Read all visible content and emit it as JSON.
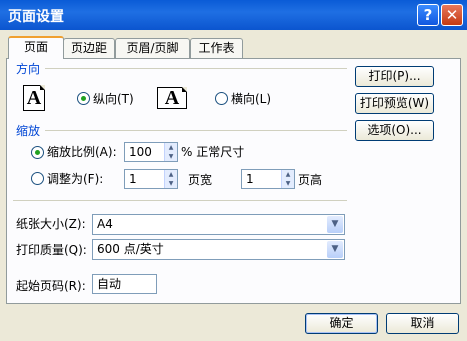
{
  "window": {
    "title": "页面设置",
    "help_glyph": "?",
    "close_glyph": "✕"
  },
  "tabs": [
    "页面",
    "页边距",
    "页眉/页脚",
    "工作表"
  ],
  "orientation": {
    "section_label": "方向",
    "portrait_icon_letter": "A",
    "landscape_icon_letter": "A",
    "portrait_label": "纵向(T)",
    "landscape_label": "横向(L)",
    "selected": "portrait"
  },
  "scaling": {
    "section_label": "缩放",
    "adjust_label": "缩放比例(A):",
    "adjust_value": "100",
    "adjust_suffix": "% 正常尺寸",
    "fit_label": "调整为(F):",
    "fit_wide_value": "1",
    "fit_wide_suffix": "页宽",
    "fit_tall_value": "1",
    "fit_tall_suffix": "页高",
    "selected": "adjust"
  },
  "paper": {
    "paper_size_label": "纸张大小(Z):",
    "paper_size_value": "A4",
    "print_quality_label": "打印质量(Q):",
    "print_quality_value": "600 点/英寸",
    "first_page_label": "起始页码(R):",
    "first_page_value": "自动"
  },
  "side_buttons": {
    "print": "打印(P)...",
    "preview": "打印预览(W)",
    "options": "选项(O)..."
  },
  "footer": {
    "ok": "确定",
    "cancel": "取消"
  },
  "colors": {
    "titlebar": "#0a5bd6",
    "section_label": "#0046d5",
    "window_bg": "#ece9d8"
  }
}
